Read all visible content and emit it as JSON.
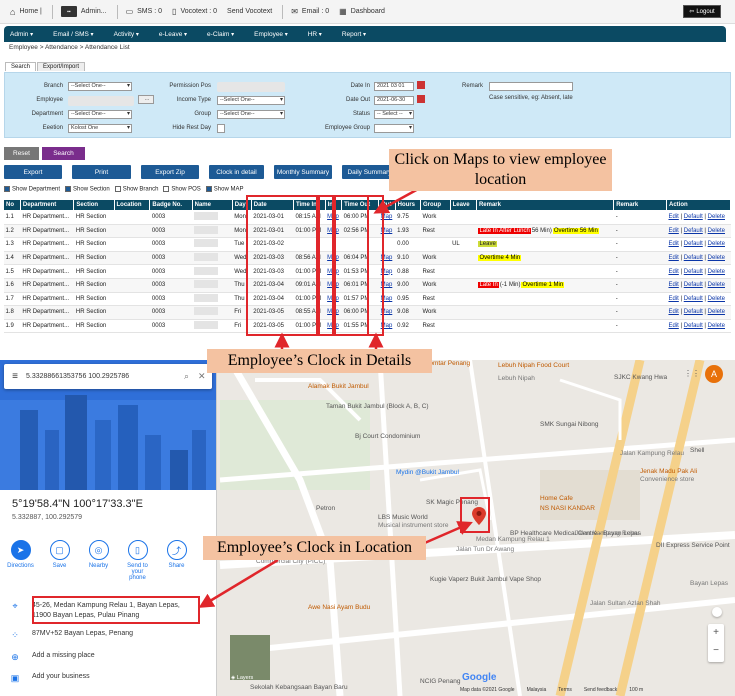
{
  "topbar": {
    "items": [
      {
        "icon": "home-icon",
        "label": "Home |"
      },
      {
        "icon": "admin-badge-icon",
        "label": "Admin..."
      },
      {
        "icon": "sms-icon",
        "label": "SMS : 0"
      },
      {
        "icon": "vocotext-icon",
        "label": "Vocotext : 0"
      },
      {
        "icon": "",
        "label": "Send Vocotext"
      },
      {
        "icon": "email-icon",
        "label": "Email : 0"
      },
      {
        "icon": "dashboard-icon",
        "label": "Dashboard"
      }
    ],
    "logout": "Logout"
  },
  "nav": [
    "Admin",
    "Email / SMS",
    "Activity",
    "e-Leave",
    "e-Claim",
    "Employee",
    "HR",
    "Report"
  ],
  "breadcrumb": "Employee > Attendance > Attendance List",
  "tabs": [
    "Search",
    "Export/Import"
  ],
  "form": {
    "branch_label": "Branch",
    "branch_value": "--Select One--",
    "employee_label": "Employee",
    "employee_button": "...",
    "department_label": "Department",
    "department_value": "--Select One--",
    "eeetion_label": "Eeetion",
    "eeetion_value": "Kolost One",
    "permission_label": "Permission Pos",
    "income_label": "Income Type",
    "income_value": "--Select One--",
    "group_label": "Group",
    "group_value": "--Select One--",
    "hide_rest_label": "Hide Rest Day",
    "datein_label": "Date In",
    "datein_value": "2021 03 01",
    "dateout_label": "Date Out",
    "dateout_value": "2021-06-30",
    "status_label": "Status",
    "status_value": "-- Select --",
    "empgroup_label": "Employee Group",
    "remark_label": "Remark",
    "remark_hint": "Case sensitive, eg: Absent, late"
  },
  "buttons1": [
    "Reset",
    "Search"
  ],
  "buttons2": [
    "Export",
    "Print",
    "Export Zip",
    "Clock in detail",
    "Monthly Summary",
    "Daily Summary"
  ],
  "shows": [
    {
      "label": "Show Department",
      "checked": true
    },
    {
      "label": "Show Section",
      "checked": true
    },
    {
      "label": "Show Branch",
      "checked": false
    },
    {
      "label": "Show POS",
      "checked": false
    },
    {
      "label": "Show MAP",
      "checked": true
    }
  ],
  "table": {
    "headers": [
      "No",
      "Department",
      "Section",
      "Location",
      "Badge No.",
      "Name",
      "Day",
      "Date",
      "Time In",
      "In",
      "Time Out",
      "Out",
      "Hours",
      "Group",
      "Leave",
      "Remark",
      "Remark",
      "Action"
    ],
    "rows": [
      {
        "no": "1.1",
        "dept": "HR Department...",
        "sec": "HR Section",
        "badge": "0003",
        "day": "Mon",
        "date": "2021-03-01",
        "tin": "08:15 AM",
        "inmap": "Map",
        "tout": "06:00 PM",
        "outmap": "Map",
        "hours": "9.75",
        "group": "Work",
        "leave": "",
        "remark": [],
        "remark2": "-"
      },
      {
        "no": "1.2",
        "dept": "HR Department...",
        "sec": "HR Section",
        "badge": "0003",
        "day": "Mon",
        "date": "2021-03-01",
        "tin": "01:00 PM",
        "inmap": "Map",
        "tout": "02:56 PM",
        "outmap": "Map",
        "hours": "1.93",
        "group": "Rest",
        "leave": "",
        "remark": [
          {
            "t": "Late In After Lunch",
            "c": "red"
          },
          {
            "t": "56 Min)",
            "c": ""
          },
          {
            "t": "Overtime 56 Min",
            "c": "yel"
          }
        ],
        "remark2": "-"
      },
      {
        "no": "1.3",
        "dept": "HR Department...",
        "sec": "HR Section",
        "badge": "0003",
        "day": "Tue",
        "date": "2021-03-02",
        "tin": "",
        "inmap": "",
        "tout": "",
        "outmap": "",
        "hours": "0.00",
        "group": "",
        "leave": "UL",
        "remark": [
          {
            "t": "Leave",
            "c": "lv"
          }
        ],
        "remark2": "-"
      },
      {
        "no": "1.4",
        "dept": "HR Department...",
        "sec": "HR Section",
        "badge": "0003",
        "day": "Wed",
        "date": "2021-03-03",
        "tin": "08:56 AM",
        "inmap": "Map",
        "tout": "06:04 PM",
        "outmap": "Map",
        "hours": "9.10",
        "group": "Work",
        "leave": "",
        "remark": [
          {
            "t": "Overtime 4 Min",
            "c": "yel"
          }
        ],
        "remark2": "-"
      },
      {
        "no": "1.5",
        "dept": "HR Department...",
        "sec": "HR Section",
        "badge": "0003",
        "day": "Wed",
        "date": "2021-03-03",
        "tin": "01:00 PM",
        "inmap": "Map",
        "tout": "01:53 PM",
        "outmap": "Map",
        "hours": "0.88",
        "group": "Rest",
        "leave": "",
        "remark": [],
        "remark2": "-"
      },
      {
        "no": "1.6",
        "dept": "HR Department...",
        "sec": "HR Section",
        "badge": "0003",
        "day": "Thu",
        "date": "2021-03-04",
        "tin": "09:01 AM",
        "inmap": "Map",
        "tout": "06:01 PM",
        "outmap": "Map",
        "hours": "9.00",
        "group": "Work",
        "leave": "",
        "remark": [
          {
            "t": "Late In",
            "c": "red"
          },
          {
            "t": "(-1 Min)",
            "c": ""
          },
          {
            "t": "Overtime 1 Min",
            "c": "yel"
          }
        ],
        "remark2": "-"
      },
      {
        "no": "1.7",
        "dept": "HR Department...",
        "sec": "HR Section",
        "badge": "0003",
        "day": "Thu",
        "date": "2021-03-04",
        "tin": "01:00 PM",
        "inmap": "Map",
        "tout": "01:57 PM",
        "outmap": "Map",
        "hours": "0.95",
        "group": "Rest",
        "leave": "",
        "remark": [],
        "remark2": "-"
      },
      {
        "no": "1.8",
        "dept": "HR Department...",
        "sec": "HR Section",
        "badge": "0003",
        "day": "Fri",
        "date": "2021-03-05",
        "tin": "08:55 AM",
        "inmap": "Map",
        "tout": "06:00 PM",
        "outmap": "Map",
        "hours": "9.08",
        "group": "Work",
        "leave": "",
        "remark": [],
        "remark2": "-"
      },
      {
        "no": "1.9",
        "dept": "HR Department...",
        "sec": "HR Section",
        "badge": "0003",
        "day": "Fri",
        "date": "2021-03-05",
        "tin": "01:00 PM",
        "inmap": "Map",
        "tout": "01:55 PM",
        "outmap": "Map",
        "hours": "0.92",
        "group": "Rest",
        "leave": "",
        "remark": [],
        "remark2": "-"
      }
    ],
    "actions": [
      "Edit",
      "Default",
      "Delete"
    ]
  },
  "callouts": {
    "maps": "Click on Maps to view employee location",
    "details": "Employee’s Clock in Details",
    "location": "Employee’s Clock in Location"
  },
  "map": {
    "search_value": "5.33288661353756 100.2925786",
    "coord_dms": "5°19'58.4\"N 100°17'33.3\"E",
    "coord_dec": "5.332887, 100.292579",
    "actions": [
      "Directions",
      "Save",
      "Nearby",
      "Send to your phone",
      "Share"
    ],
    "address": "45-26, Medan Kampung Relau 1, Bayan Lepas, 11900 Bayan Lepas, Pulau Pinang",
    "plus_code": "87MV+52 Bayan Lepas, Penang",
    "add_place": "Add a missing place",
    "add_business": "Add your business",
    "layers": "Layers",
    "avatar": "A",
    "footer": [
      "Map data ©2021 Google",
      "Malaysia",
      "Terms",
      "Send feedback",
      "100 m"
    ],
    "labels": [
      "Lebuh Nipah Food Court",
      "Lebuh Nipah",
      "Komtar Penang",
      "Alamak Bukit Jambul",
      "Taman Bukit Jambul (Block A, B, C)",
      "Bj Court Condominium",
      "SMK Sungai Nibong",
      "SJKC Kwang Hwa",
      "Jalan Kampung Relau",
      "Shell",
      "Mydin @Bukit Jambul",
      "SK Magic Penang",
      "Home Cafe",
      "NS NASI KANDAR",
      "BP Healthcare Medical Centre - Bayan Lepas",
      "LBS Music World",
      "Musical instrument store",
      "Petron",
      "Medan Kampung Relau 1",
      "Jalan Kampung Relau",
      "Jenak Madu Pak Ali",
      "Convenience store",
      "DII Express Service Point",
      "Bayan Lepas",
      "Kugie Vaperz Bukit Jambul Vape Shop",
      "Awe Nasi Ayam Budu",
      "NCIG Penang",
      "Sekolah Kebangsaan Bayan Baru",
      "Jalan Sultan Azlan Shah",
      "Jalan Tun Dr Awang",
      "Commercial City (PICC)"
    ]
  },
  "colors": {
    "nav": "#0b4a63",
    "callout": "#f4c2a1",
    "highlight": "#e0262b",
    "link": "#1a73e8"
  }
}
